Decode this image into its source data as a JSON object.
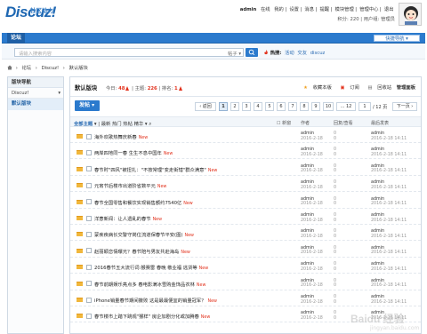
{
  "header": {
    "logo_sub": "社区动力",
    "logo_main": "Discuz!",
    "username": "admin",
    "online_label": "在线",
    "user_links": [
      "我的",
      "设置",
      "消息",
      "提醒",
      "模块管理",
      "管理中心",
      "退出"
    ],
    "credit_label": "积分: 220",
    "group_label": "用户组: 管理员"
  },
  "nav": {
    "forum": "论坛",
    "quick": "快捷导航"
  },
  "search": {
    "placeholder": "请输入搜索内容",
    "type": "帖子",
    "hot_label": "热搜:",
    "hot_items": [
      "活动",
      "交友",
      "discuz"
    ]
  },
  "breadcrumb": [
    "论坛",
    "Discuz!",
    "默认版块"
  ],
  "sidebar": {
    "title": "版块导航",
    "parent": "Discuz!",
    "current": "默认版块"
  },
  "forum": {
    "name": "默认版块",
    "today_label": "今日:",
    "today_value": "48",
    "topic_label": "主题:",
    "topic_value": "226",
    "rank_label": "排名:",
    "rank_value": "1",
    "actions": {
      "fav": "收藏本版",
      "sub": "订阅",
      "recycle": "回收站",
      "manage": "管理面板"
    },
    "post_button": "发帖",
    "pager": {
      "back": "返回",
      "pages": [
        "1",
        "2",
        "3",
        "4",
        "5",
        "6",
        "7",
        "8",
        "9",
        "10"
      ],
      "ellipsis": "... 12",
      "input": "1",
      "total": "/ 12 页",
      "next": "下一页"
    },
    "filters": [
      "全部主题",
      "最新",
      "热门",
      "热帖",
      "精华"
    ],
    "col_new_window": "新窗",
    "col_author": "作者",
    "col_reply": "回复/查看",
    "col_last": "最后发表"
  },
  "threads": [
    {
      "title": "海外欢歌热舞庆新春",
      "new": "New",
      "author": "admin",
      "date": "2016-2-18",
      "reply": "0",
      "view": "0",
      "last": "admin",
      "lastdate": "2016-2-18 14:11"
    },
    {
      "title": "两岸四地同一春 生生不息中国年",
      "new": "New",
      "author": "admin",
      "date": "2016-2-18",
      "reply": "0",
      "view": "0",
      "last": "admin",
      "lastdate": "2016-2-18 14:11"
    },
    {
      "title": "春节时\"四风\"被扭扎：\"不按常理\"变走街辖\"群众满意\"",
      "new": "New",
      "author": "admin",
      "date": "2016-2-18",
      "reply": "0",
      "view": "0",
      "last": "admin",
      "lastdate": "2016-2-18 14:11"
    },
    {
      "title": "元宵节后楼市出道阶省数平元",
      "new": "New",
      "author": "admin",
      "date": "2016-2-18",
      "reply": "0",
      "view": "0",
      "last": "admin",
      "lastdate": "2016-2-18 14:11"
    },
    {
      "title": "春节全国零售和餐饮实现销售额约7540亿",
      "new": "New",
      "author": "admin",
      "date": "2016-2-18",
      "reply": "0",
      "view": "0",
      "last": "admin",
      "lastdate": "2016-2-18 14:11"
    },
    {
      "title": "洋葱新闻：让人遗乱的春节",
      "new": "New",
      "author": "admin",
      "date": "2016-2-18",
      "reply": "0",
      "view": "0",
      "last": "admin",
      "lastdate": "2016-2-18 14:11"
    },
    {
      "title": "蒙疾疾病长交警守岗位流道保春节平安(图)",
      "new": "New",
      "author": "admin",
      "date": "2016-2-18",
      "reply": "0",
      "view": "0",
      "last": "admin",
      "lastdate": "2016-2-18 14:11"
    },
    {
      "title": "赵丽颖恋情曝光？春节陪与男友共赴海岛",
      "new": "New",
      "author": "admin",
      "date": "2016-2-18",
      "reply": "0",
      "view": "0",
      "last": "admin",
      "lastdate": "2016-2-18 14:11"
    },
    {
      "title": "2016春节五大流行词:猴赛雷 春晚 敬业福 逃货等",
      "new": "New",
      "author": "admin",
      "date": "2016-2-18",
      "reply": "0",
      "view": "0",
      "last": "admin",
      "lastdate": "2016-2-18 14:11"
    },
    {
      "title": "春节前期娱乐亮点多 春电影满冰雪购金饰品农林",
      "new": "New",
      "author": "admin",
      "date": "2016-2-18",
      "reply": "0",
      "view": "0",
      "last": "admin",
      "lastdate": "2016-2-18 14:11"
    },
    {
      "title": "iPhone销量春节期间撒败 这是最最便宜的销量冠军？",
      "new": "New",
      "author": "admin",
      "date": "2016-2-18",
      "reply": "0",
      "view": "0",
      "last": "admin",
      "lastdate": "2016-2-18 14:11"
    },
    {
      "title": "春节楼市上踏下跳观\"猴样\" 房企加剧分化或加腾春",
      "new": "New",
      "author": "admin",
      "date": "2016-2-18",
      "reply": "0",
      "view": "0",
      "last": "admin",
      "lastdate": "2016-2-18 14:11"
    }
  ],
  "watermark": {
    "main": "Baidu 经验",
    "sub": "jingyan.baidu.com"
  }
}
